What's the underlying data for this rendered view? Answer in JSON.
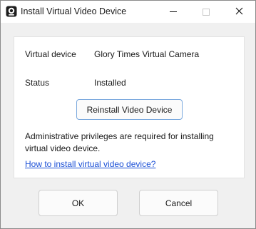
{
  "window": {
    "title": "Install Virtual Video Device"
  },
  "icons": {
    "app": "webcam-icon",
    "minimize": "minimize-icon",
    "maximize": "maximize-icon",
    "close": "close-icon"
  },
  "info": {
    "device_label": "Virtual device",
    "device_value": "Glory Times Virtual Camera",
    "status_label": "Status",
    "status_value": "Installed"
  },
  "actions": {
    "reinstall_label": "Reinstall Video Device"
  },
  "note": "Administrative privileges are required for installing virtual video device.",
  "help_link": "How to install virtual video device?",
  "footer": {
    "ok_label": "OK",
    "cancel_label": "Cancel"
  },
  "colors": {
    "link": "#1a4fd6",
    "button_focus_border": "#7ba9de",
    "dialog_background": "#f0f0f0",
    "panel_background": "#ffffff"
  }
}
